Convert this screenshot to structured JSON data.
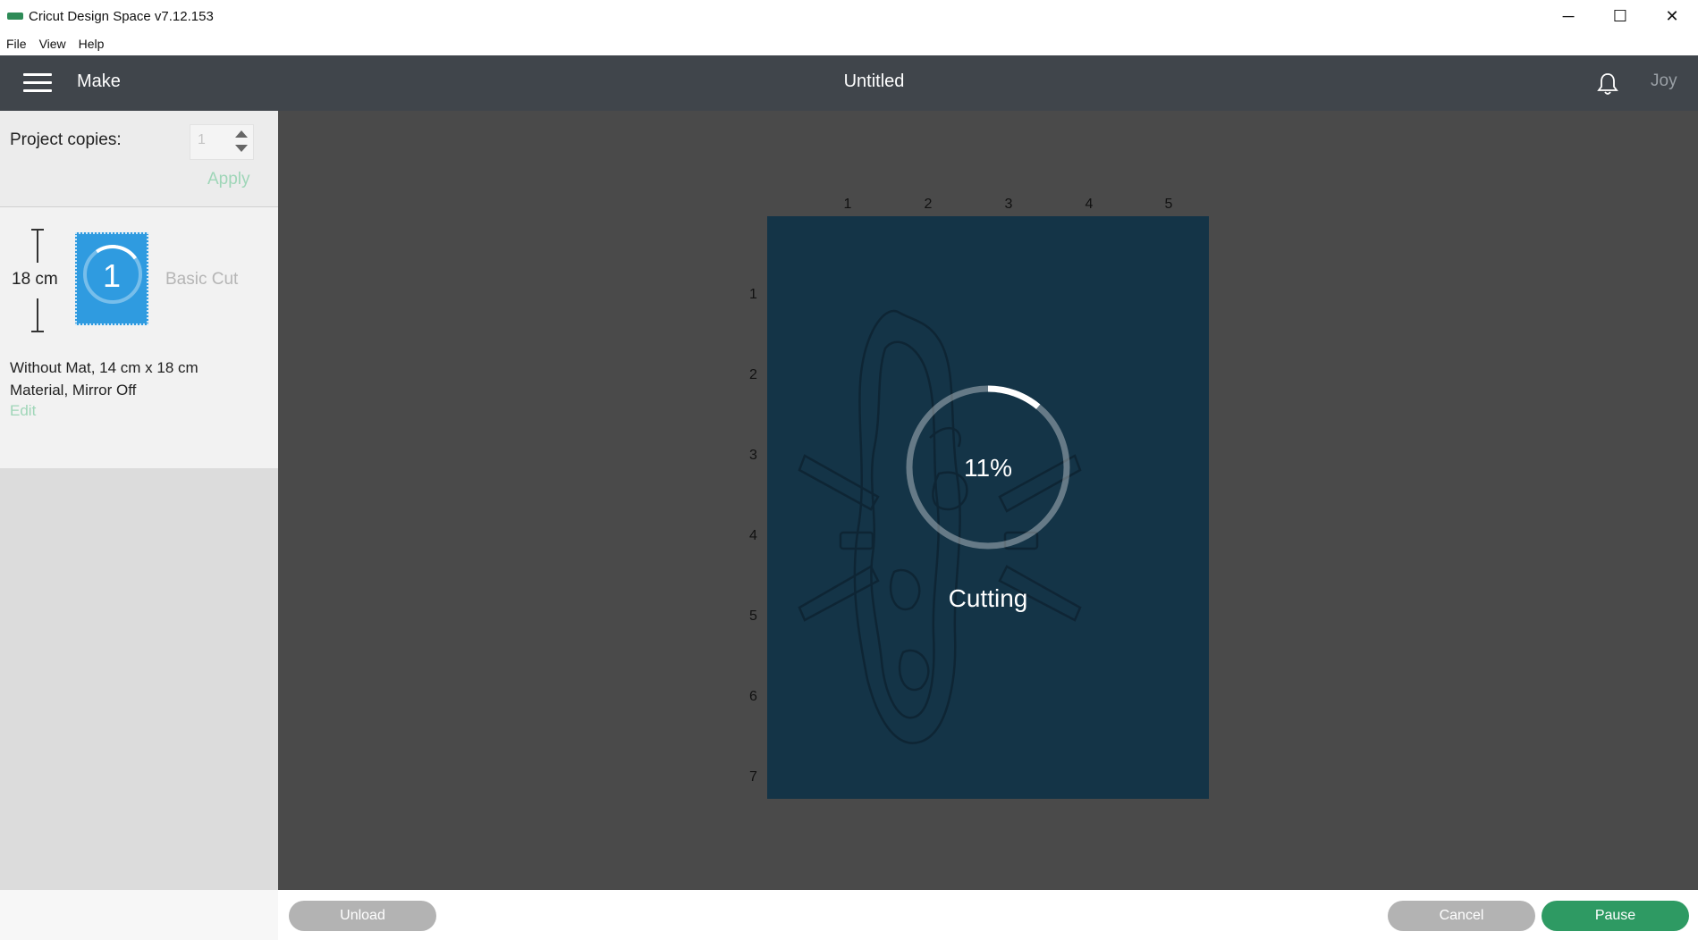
{
  "window": {
    "title": "Cricut Design Space  v7.12.153",
    "minimize": "─",
    "maximize": "☐",
    "close": "✕"
  },
  "menu": [
    "File",
    "View",
    "Help"
  ],
  "header": {
    "section": "Make",
    "project_title": "Untitled",
    "user": "Joy"
  },
  "sidebar": {
    "copies_label": "Project copies:",
    "copies_value": "1",
    "apply_label": "Apply",
    "mat": {
      "height_label": "18 cm",
      "number": "1",
      "cut_type": "Basic Cut",
      "info_line1": "Without Mat, 14 cm x 18 cm",
      "info_line2": "Material, Mirror Off",
      "edit_label": "Edit"
    }
  },
  "canvas": {
    "ruler_x": [
      "1",
      "2",
      "3",
      "4",
      "5"
    ],
    "ruler_y": [
      "1",
      "2",
      "3",
      "4",
      "5",
      "6",
      "7"
    ],
    "progress_percent": 11,
    "progress_label": "11%",
    "status": "Cutting"
  },
  "footer": {
    "unload_label": "Unload",
    "cancel_label": "Cancel",
    "pause_label": "Pause"
  },
  "colors": {
    "header_bg": "#40454b",
    "mat_bg": "#143447",
    "accent_green": "#2e9a63",
    "thumb_blue": "#2f9be0"
  }
}
